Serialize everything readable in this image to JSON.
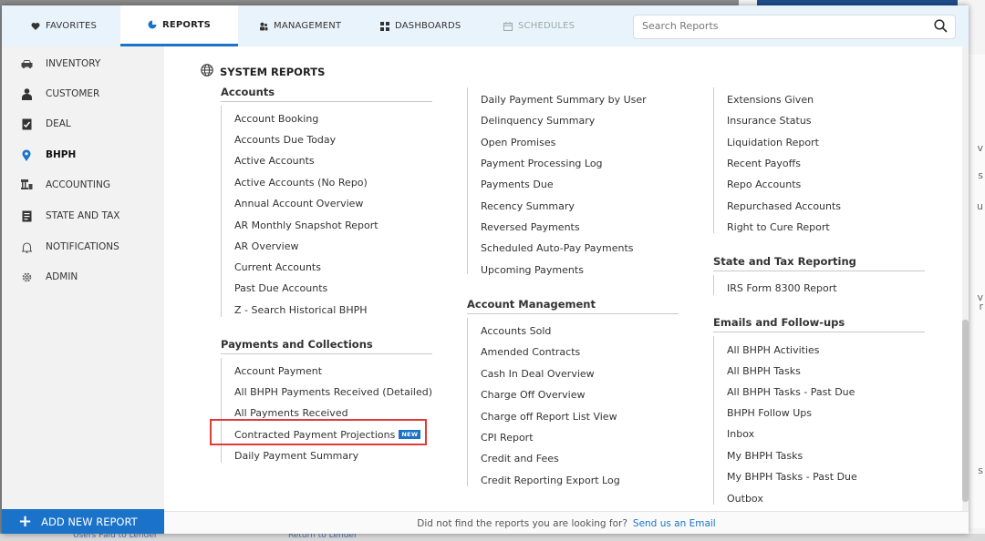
{
  "background": {
    "right_edge_chars": [
      "v",
      "s",
      "u",
      "v",
      "r",
      "s"
    ],
    "bottom_links": [
      "Users Paid to Lender",
      "Return to Lender"
    ]
  },
  "topnav": {
    "tabs": [
      {
        "label": "FAVORITES",
        "icon": "heart-icon",
        "state": "normal"
      },
      {
        "label": "REPORTS",
        "icon": "pie-chart-icon",
        "state": "active"
      },
      {
        "label": "MANAGEMENT",
        "icon": "people-icon",
        "state": "normal"
      },
      {
        "label": "DASHBOARDS",
        "icon": "grid-icon",
        "state": "normal"
      },
      {
        "label": "SCHEDULES",
        "icon": "calendar-icon",
        "state": "disabled"
      }
    ],
    "search_placeholder": "Search Reports"
  },
  "sidebar": {
    "items": [
      {
        "label": "INVENTORY",
        "icon": "car-icon"
      },
      {
        "label": "CUSTOMER",
        "icon": "person-icon"
      },
      {
        "label": "DEAL",
        "icon": "checklist-icon"
      },
      {
        "label": "BHPH",
        "icon": "location-pin-icon",
        "active": true
      },
      {
        "label": "ACCOUNTING",
        "icon": "bank-icon"
      },
      {
        "label": "STATE AND TAX",
        "icon": "ledger-icon"
      },
      {
        "label": "NOTIFICATIONS",
        "icon": "bell-icon"
      },
      {
        "label": "ADMIN",
        "icon": "gear-icon"
      }
    ],
    "add_button": "ADD NEW REPORT"
  },
  "content": {
    "title": "SYSTEM REPORTS",
    "accounts": {
      "heading": "Accounts",
      "items": [
        "Account Booking",
        "Accounts Due Today",
        "Active Accounts",
        "Active Accounts (No Repo)",
        "Annual Account Overview",
        "AR Monthly Snapshot Report",
        "AR Overview",
        "Current Accounts",
        "Past Due Accounts",
        "Z - Search Historical BHPH"
      ]
    },
    "payments": {
      "heading": "Payments and Collections",
      "items": [
        "Account Payment",
        "All BHPH Payments Received (Detailed)",
        "All Payments Received",
        "Contracted Payment Projections",
        "Daily Payment Summary"
      ],
      "new_badge": "NEW"
    },
    "col2_items": [
      "Daily Payment Summary by User",
      "Delinquency Summary",
      "Open Promises",
      "Payment Processing Log",
      "Payments Due",
      "Recency Summary",
      "Reversed Payments",
      "Scheduled Auto-Pay Payments",
      "Upcoming Payments"
    ],
    "account_mgmt": {
      "heading": "Account Management",
      "items": [
        "Accounts Sold",
        "Amended Contracts",
        "Cash In Deal Overview",
        "Charge Off Overview",
        "Charge off Report List View",
        "CPI Report",
        "Credit and Fees",
        "Credit Reporting Export Log"
      ]
    },
    "col3_items": [
      "Extensions Given",
      "Insurance Status",
      "Liquidation Report",
      "Recent Payoffs",
      "Repo Accounts",
      "Repurchased Accounts",
      "Right to Cure Report"
    ],
    "state_tax": {
      "heading": "State and Tax Reporting",
      "items": [
        "IRS Form 8300 Report"
      ]
    },
    "emails": {
      "heading": "Emails and Follow-ups",
      "items": [
        "All BHPH Activities",
        "All BHPH Tasks",
        "All BHPH Tasks - Past Due",
        "BHPH Follow Ups",
        "Inbox",
        "My BHPH Tasks",
        "My BHPH Tasks - Past Due",
        "Outbox"
      ]
    }
  },
  "footer": {
    "text": "Did not find the reports you are looking for?",
    "link": "Send us an Email"
  },
  "colors": {
    "accent": "#1a73c8",
    "highlight": "#e03a3a",
    "nav_bg": "#e9f3fb",
    "sidebar_bg": "#f2f2f2"
  }
}
